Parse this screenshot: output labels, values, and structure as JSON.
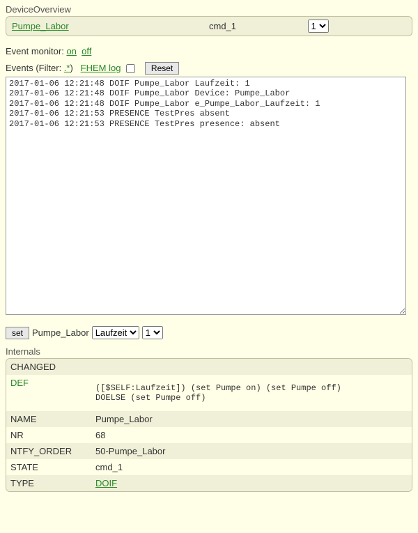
{
  "overview": {
    "title": "DeviceOverview",
    "name": "Pumpe_Labor",
    "state": "cmd_1",
    "select_value": "1"
  },
  "event_monitor": {
    "label": "Event monitor:",
    "on": "on",
    "off": "off"
  },
  "filter": {
    "label_prefix": "Events (Filter: ",
    "pattern": ".*",
    "label_suffix": ")",
    "fhem_log": "FHEM log",
    "reset": "Reset"
  },
  "events": "2017-01-06 12:21:48 DOIF Pumpe_Labor Laufzeit: 1\n2017-01-06 12:21:48 DOIF Pumpe_Labor Device: Pumpe_Labor\n2017-01-06 12:21:48 DOIF Pumpe_Labor e_Pumpe_Labor_Laufzeit: 1\n2017-01-06 12:21:53 PRESENCE TestPres absent\n2017-01-06 12:21:53 PRESENCE TestPres presence: absent",
  "set": {
    "button": "set",
    "device": "Pumpe_Labor",
    "reading": "Laufzeit",
    "value": "1"
  },
  "internals": {
    "title": "Internals",
    "rows": {
      "changed": "CHANGED",
      "def_label": "DEF",
      "def_value": "([$SELF:Laufzeit]) (set Pumpe on) (set Pumpe off)\nDOELSE (set Pumpe off)",
      "name_label": "NAME",
      "name_value": "Pumpe_Labor",
      "nr_label": "NR",
      "nr_value": "68",
      "ntfy_label": "NTFY_ORDER",
      "ntfy_value": "50-Pumpe_Labor",
      "state_label": "STATE",
      "state_value": "cmd_1",
      "type_label": "TYPE",
      "type_value": "DOIF"
    }
  }
}
